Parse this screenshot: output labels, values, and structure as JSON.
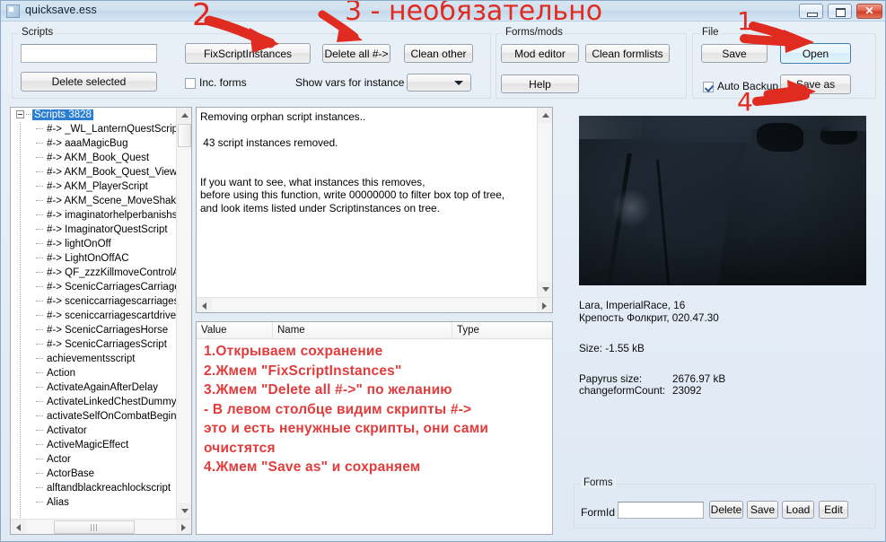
{
  "window": {
    "title": "quicksave.ess",
    "icon": "app-icon",
    "controls": {
      "minimize": "–",
      "maximize": "▭",
      "close": "✕"
    }
  },
  "scripts_group": {
    "legend": "Scripts",
    "filter_value": "",
    "filter_placeholder": "",
    "delete_selected": "Delete selected",
    "fix_script_instances": "FixScriptInstances",
    "delete_all": "Delete all #->",
    "clean_other": "Clean other",
    "inc_forms_label": "Inc. forms",
    "inc_forms_checked": false,
    "show_vars_label": "Show vars for instance",
    "instance_combo_value": ""
  },
  "forms_group": {
    "legend": "Forms/mods",
    "mod_editor": "Mod editor",
    "clean_formlists": "Clean formlists",
    "help": "Help"
  },
  "file_group": {
    "legend": "File",
    "save": "Save",
    "open": "Open",
    "save_as": "Save as",
    "auto_backup_label": "Auto Backup",
    "auto_backup_checked": true
  },
  "tree": {
    "root": {
      "label": "Scripts 3828",
      "selected": true
    },
    "items": [
      "#-> _WL_LanternQuestScript",
      "#-> aaaMagicBug",
      "#-> AKM_Book_Quest",
      "#-> AKM_Book_Quest_View",
      "#-> AKM_PlayerScript",
      "#-> AKM_Scene_MoveShake",
      "#-> imaginatorhelperbanishscr",
      "#-> ImaginatorQuestScript",
      "#-> lightOnOff",
      "#-> LightOnOffAC",
      "#-> QF_zzzKillmoveControlAu",
      "#-> ScenicCarriagesCarriage",
      "#-> sceniccarriagescarriagesy",
      "#-> sceniccarriagescartdrivers",
      "#-> ScenicCarriagesHorse",
      "#-> ScenicCarriagesScript",
      "achievementsscript",
      "Action",
      "ActivateAgainAfterDelay",
      "ActivateLinkedChestDummyS",
      "activateSelfOnCombatBegin",
      "Activator",
      "ActiveMagicEffect",
      "Actor",
      "ActorBase",
      "alftandblackreachlockscript",
      "Alias"
    ]
  },
  "output": {
    "text": "Removing orphan script instances..\n\n 43 script instances removed.\n\n\nIf you want to see, what instances this removes,\nbefore using this function, write 00000000 to filter box top of tree,\nand look items listed under Scriptinstances on tree."
  },
  "vars_list": {
    "columns": [
      "Value",
      "Name",
      "Type"
    ],
    "rows": []
  },
  "instructions": {
    "lines": [
      "1.Открываем сохранение",
      "2.Жмем \"FixScriptInstances\"",
      "3.Жмем \"Delete all #->\" по желанию",
      "- В левом столбце видим скрипты #->",
      "это и есть ненужные скрипты, они сами",
      "очистятся",
      "4.Жмем \"Save as\" и сохраняем"
    ],
    "color": "#e23b3b"
  },
  "save_info": {
    "character_line": "Lara, ImperialRace, 16",
    "location_line": "Крепость Фолкрит, 020.47.30",
    "size_label": "Size: -1.55 kB",
    "papyrus_label": "Papyrus size:",
    "papyrus_value": "2676.97 kB",
    "changeform_label": "changeformCount:",
    "changeform_value": "23092"
  },
  "forms_bottom": {
    "legend": "Forms",
    "formid_label": "FormId",
    "formid_value": "",
    "delete": "Delete",
    "save": "Save",
    "load": "Load",
    "edit": "Edit"
  },
  "annotations": {
    "color": "#e02b20",
    "n1": "1",
    "n2": "2",
    "n3": "3 - необязательно",
    "n4": "4"
  }
}
